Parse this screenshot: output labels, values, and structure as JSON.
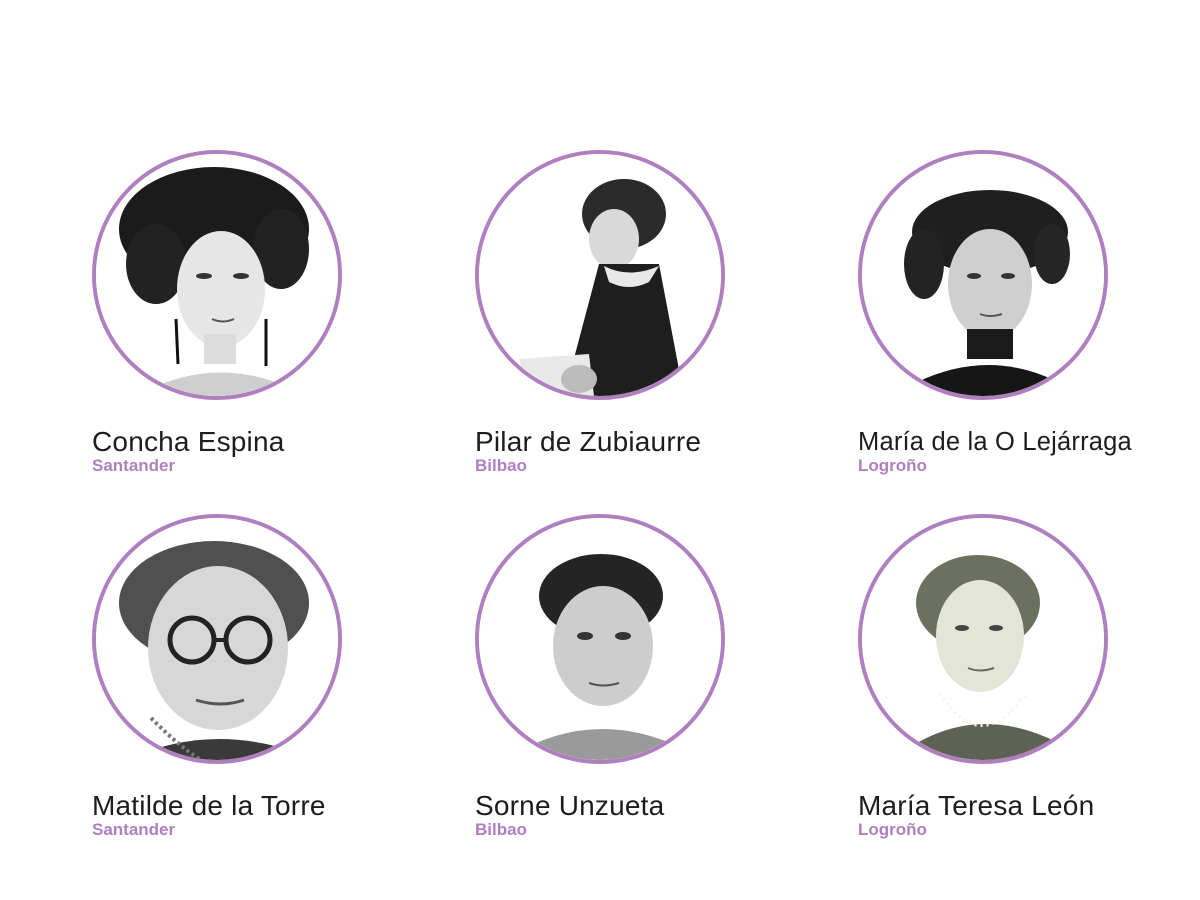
{
  "accent_color": "#b07fc0",
  "women": [
    {
      "name": "Concha Espina",
      "city": "Santander",
      "photo_icon": "portrait-photo"
    },
    {
      "name": "Pilar de Zubiaurre",
      "city": "Bilbao",
      "photo_icon": "portrait-photo"
    },
    {
      "name": "María de la O Lejárraga",
      "city": "Logroño",
      "photo_icon": "portrait-photo"
    },
    {
      "name": "Matilde de la Torre",
      "city": "Santander",
      "photo_icon": "portrait-photo"
    },
    {
      "name": "Sorne Unzueta",
      "city": "Bilbao",
      "photo_icon": "portrait-photo"
    },
    {
      "name": "María Teresa León",
      "city": "Logroño",
      "photo_icon": "portrait-photo"
    }
  ]
}
